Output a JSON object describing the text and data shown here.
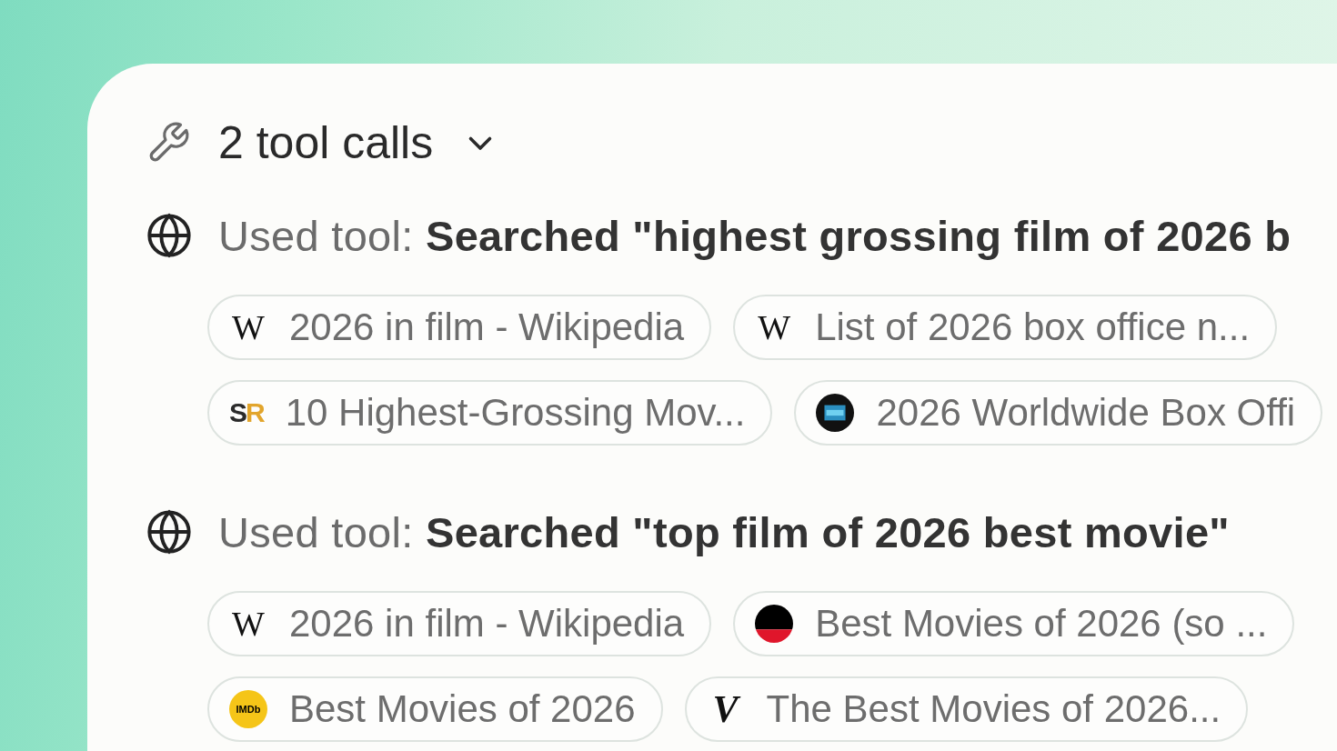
{
  "header": {
    "title": "2 tool calls",
    "expanded": false
  },
  "tool_calls": [
    {
      "text": "Used tool: **Searched \"highest grossing film of 2026 b**",
      "source_rows": [
        {
          "sources": [
            {
              "kind": "wiki",
              "logo_text": "W",
              "title": "2026 in film - Wikipedia"
            },
            {
              "kind": "wiki",
              "logo_text": "W",
              "title": "List of 2026 box office n..."
            }
          ]
        },
        {
          "sources": [
            {
              "kind": "sr",
              "logo_text": "SR",
              "title": "10 Highest-Grossing Mov..."
            },
            {
              "kind": "dark-circle",
              "title": "2026 Worldwide Box Offi"
            }
          ]
        }
      ]
    },
    {
      "text": "Used tool: **Searched \"top film of 2026 best movie\"**",
      "source_rows": [
        {
          "sources": [
            {
              "kind": "wiki",
              "logo_text": "W",
              "title": "2026 in film - Wikipedia"
            },
            {
              "kind": "split-circle",
              "title": "Best Movies of 2026 (so ..."
            }
          ]
        },
        {
          "sources": [
            {
              "kind": "imdb",
              "logo_text": "IMDb",
              "title": "Best Movies of 2026"
            },
            {
              "kind": "v",
              "logo_text": "V",
              "title": "The Best Movies of 2026..."
            }
          ]
        }
      ]
    }
  ]
}
